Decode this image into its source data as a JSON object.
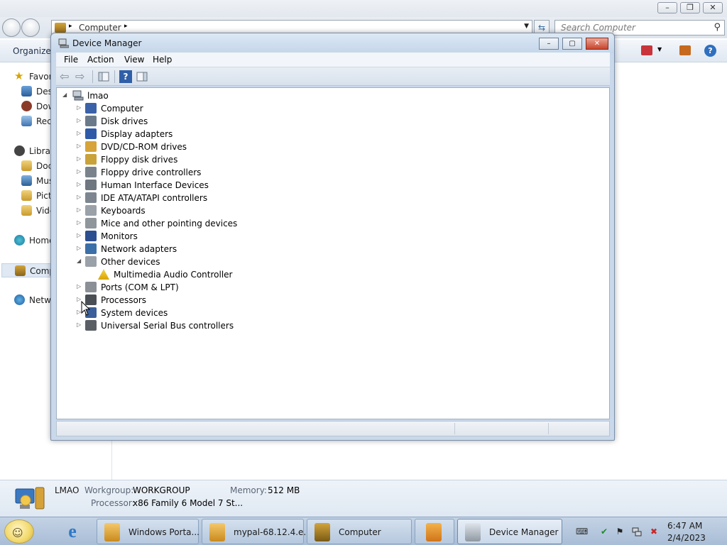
{
  "explorer": {
    "address": {
      "path": "Computer",
      "separator_glyph": "▸",
      "dropdown_glyph": "▼"
    },
    "search": {
      "placeholder": "Search Computer",
      "icon": "search-icon"
    },
    "refresh_glyph": "⇆",
    "caption_glyphs": {
      "minimize": "–",
      "maximize": "❐",
      "close": "✕"
    },
    "toolbar": {
      "organize": "Organize"
    },
    "nav": {
      "favorites": {
        "label": "Favor",
        "icon": "star-icon"
      },
      "desktop": {
        "label": "Des",
        "icon": "desktop-icon"
      },
      "downloads": {
        "label": "Dow",
        "icon": "downloads-icon"
      },
      "recent": {
        "label": "Rec",
        "icon": "recent-places-icon"
      },
      "libraries": {
        "label": "Librar",
        "icon": "libraries-icon"
      },
      "documents": {
        "label": "Doc",
        "icon": "documents-icon"
      },
      "music": {
        "label": "Mus",
        "icon": "music-icon"
      },
      "pictures": {
        "label": "Pict",
        "icon": "pictures-icon"
      },
      "videos": {
        "label": "Vide",
        "icon": "videos-icon"
      },
      "homegroup": {
        "label": "Home",
        "icon": "homegroup-icon"
      },
      "computer": {
        "label": "Comp",
        "icon": "computer-icon"
      },
      "network": {
        "label": "Netw",
        "icon": "network-icon"
      }
    },
    "details": {
      "name": "LMAO",
      "workgroup_label": "Workgroup:",
      "workgroup_value": "WORKGROUP",
      "memory_label": "Memory:",
      "memory_value": "512 MB",
      "processor_label": "Processor:",
      "processor_value": "x86 Family 6 Model 7 St..."
    }
  },
  "device_manager": {
    "title": "Device Manager",
    "caption_glyphs": {
      "minimize": "–",
      "maximize": "▢",
      "close": "✕"
    },
    "menu": [
      "File",
      "Action",
      "View",
      "Help"
    ],
    "toolbar_glyphs": {
      "back": "⇦",
      "forward": "⇨",
      "help": "?"
    },
    "tree": {
      "root": "lmao",
      "categories": [
        {
          "label": "Computer",
          "icon": "computer-icon",
          "expanded": false
        },
        {
          "label": "Disk drives",
          "icon": "disk-drive-icon",
          "expanded": false
        },
        {
          "label": "Display adapters",
          "icon": "display-adapter-icon",
          "expanded": false
        },
        {
          "label": "DVD/CD-ROM drives",
          "icon": "dvd-drive-icon",
          "expanded": false
        },
        {
          "label": "Floppy disk drives",
          "icon": "floppy-disk-icon",
          "expanded": false
        },
        {
          "label": "Floppy drive controllers",
          "icon": "floppy-controller-icon",
          "expanded": false
        },
        {
          "label": "Human Interface Devices",
          "icon": "hid-icon",
          "expanded": false
        },
        {
          "label": "IDE ATA/ATAPI controllers",
          "icon": "ide-controller-icon",
          "expanded": false
        },
        {
          "label": "Keyboards",
          "icon": "keyboard-icon",
          "expanded": false
        },
        {
          "label": "Mice and other pointing devices",
          "icon": "mouse-icon",
          "expanded": false
        },
        {
          "label": "Monitors",
          "icon": "monitor-icon",
          "expanded": false
        },
        {
          "label": "Network adapters",
          "icon": "network-adapter-icon",
          "expanded": false
        },
        {
          "label": "Other devices",
          "icon": "other-devices-icon",
          "expanded": true,
          "children": [
            {
              "label": "Multimedia Audio Controller",
              "icon": "warning-device-icon"
            }
          ]
        },
        {
          "label": "Ports (COM & LPT)",
          "icon": "port-icon",
          "expanded": false
        },
        {
          "label": "Processors",
          "icon": "processor-icon",
          "expanded": false
        },
        {
          "label": "System devices",
          "icon": "system-device-icon",
          "expanded": false
        },
        {
          "label": "Universal Serial Bus controllers",
          "icon": "usb-icon",
          "expanded": false
        }
      ]
    },
    "glyphs": {
      "collapsed": "▷",
      "expanded": "◢"
    }
  },
  "taskbar": {
    "start_glyph": "☺",
    "ie_glyph": "e",
    "buttons": [
      {
        "label": "Windows Porta...",
        "icon": "portable-app-icon",
        "active": false
      },
      {
        "label": "mypal-68.12.4.e...",
        "icon": "installer-icon",
        "active": false
      },
      {
        "label": "Computer",
        "icon": "computer-icon",
        "active": false
      },
      {
        "label": "",
        "icon": "media-player-icon",
        "active": false
      },
      {
        "label": "Device Manager",
        "icon": "device-manager-icon",
        "active": true
      }
    ],
    "tray_glyphs": {
      "keyboard": "⌨",
      "flag": "⚑",
      "volume_muted": "✖",
      "check": "✔"
    },
    "clock": {
      "time": "6:47 AM",
      "date": "2/4/2023"
    }
  },
  "colors": {
    "accent": "#3a6ea5",
    "taskbar": "#b5c8de",
    "warning": "#e8b400",
    "close_button": "#c9442c"
  }
}
